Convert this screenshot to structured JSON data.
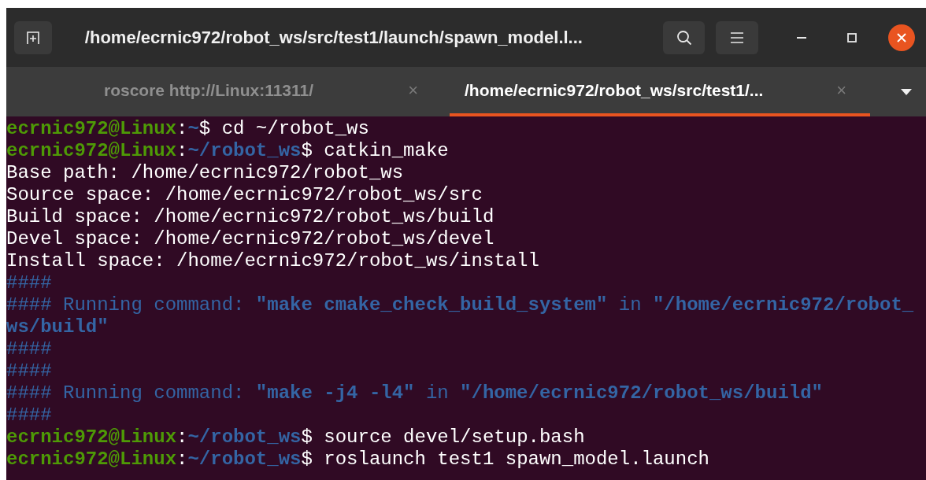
{
  "window": {
    "title": "/home/ecrnic972/robot_ws/src/test1/launch/spawn_model.l..."
  },
  "tabs": [
    {
      "label": "roscore http://Linux:11311/",
      "close": "×",
      "selected": false
    },
    {
      "label": "/home/ecrnic972/robot_ws/src/test1/...",
      "close": "×",
      "selected": true
    }
  ],
  "terminal": {
    "lines": [
      [
        {
          "kind": "user",
          "text": "ecrnic972@Linux"
        },
        {
          "kind": "plain",
          "text": ":"
        },
        {
          "kind": "path",
          "text": "~"
        },
        {
          "kind": "plain",
          "text": "$ cd ~/robot_ws"
        }
      ],
      [
        {
          "kind": "user",
          "text": "ecrnic972@Linux"
        },
        {
          "kind": "plain",
          "text": ":"
        },
        {
          "kind": "path",
          "text": "~/robot_ws"
        },
        {
          "kind": "plain",
          "text": "$ catkin_make"
        }
      ],
      [
        {
          "kind": "plain",
          "text": "Base path: /home/ecrnic972/robot_ws"
        }
      ],
      [
        {
          "kind": "plain",
          "text": "Source space: /home/ecrnic972/robot_ws/src"
        }
      ],
      [
        {
          "kind": "plain",
          "text": "Build space: /home/ecrnic972/robot_ws/build"
        }
      ],
      [
        {
          "kind": "plain",
          "text": "Devel space: /home/ecrnic972/robot_ws/devel"
        }
      ],
      [
        {
          "kind": "plain",
          "text": "Install space: /home/ecrnic972/robot_ws/install"
        }
      ],
      [
        {
          "kind": "info",
          "text": "####"
        }
      ],
      [
        {
          "kind": "info",
          "text": "#### Running command: "
        },
        {
          "kind": "info_bold",
          "text": "\"make cmake_check_build_system\""
        },
        {
          "kind": "info",
          "text": " in "
        },
        {
          "kind": "info_bold",
          "text": "\"/home/ecrnic972/robot_"
        }
      ],
      [
        {
          "kind": "info_bold",
          "text": "ws/build\""
        }
      ],
      [
        {
          "kind": "info",
          "text": "####"
        }
      ],
      [
        {
          "kind": "info",
          "text": "####"
        }
      ],
      [
        {
          "kind": "info",
          "text": "#### Running command: "
        },
        {
          "kind": "info_bold",
          "text": "\"make -j4 -l4\""
        },
        {
          "kind": "info",
          "text": " in "
        },
        {
          "kind": "info_bold",
          "text": "\"/home/ecrnic972/robot_ws/build\""
        }
      ],
      [
        {
          "kind": "info",
          "text": "####"
        }
      ],
      [
        {
          "kind": "user",
          "text": "ecrnic972@Linux"
        },
        {
          "kind": "plain",
          "text": ":"
        },
        {
          "kind": "path",
          "text": "~/robot_ws"
        },
        {
          "kind": "plain",
          "text": "$ source devel/setup.bash"
        }
      ],
      [
        {
          "kind": "user",
          "text": "ecrnic972@Linux"
        },
        {
          "kind": "plain",
          "text": ":"
        },
        {
          "kind": "path",
          "text": "~/robot_ws"
        },
        {
          "kind": "plain",
          "text": "$ roslaunch test1 spawn_model.launch"
        }
      ]
    ]
  }
}
